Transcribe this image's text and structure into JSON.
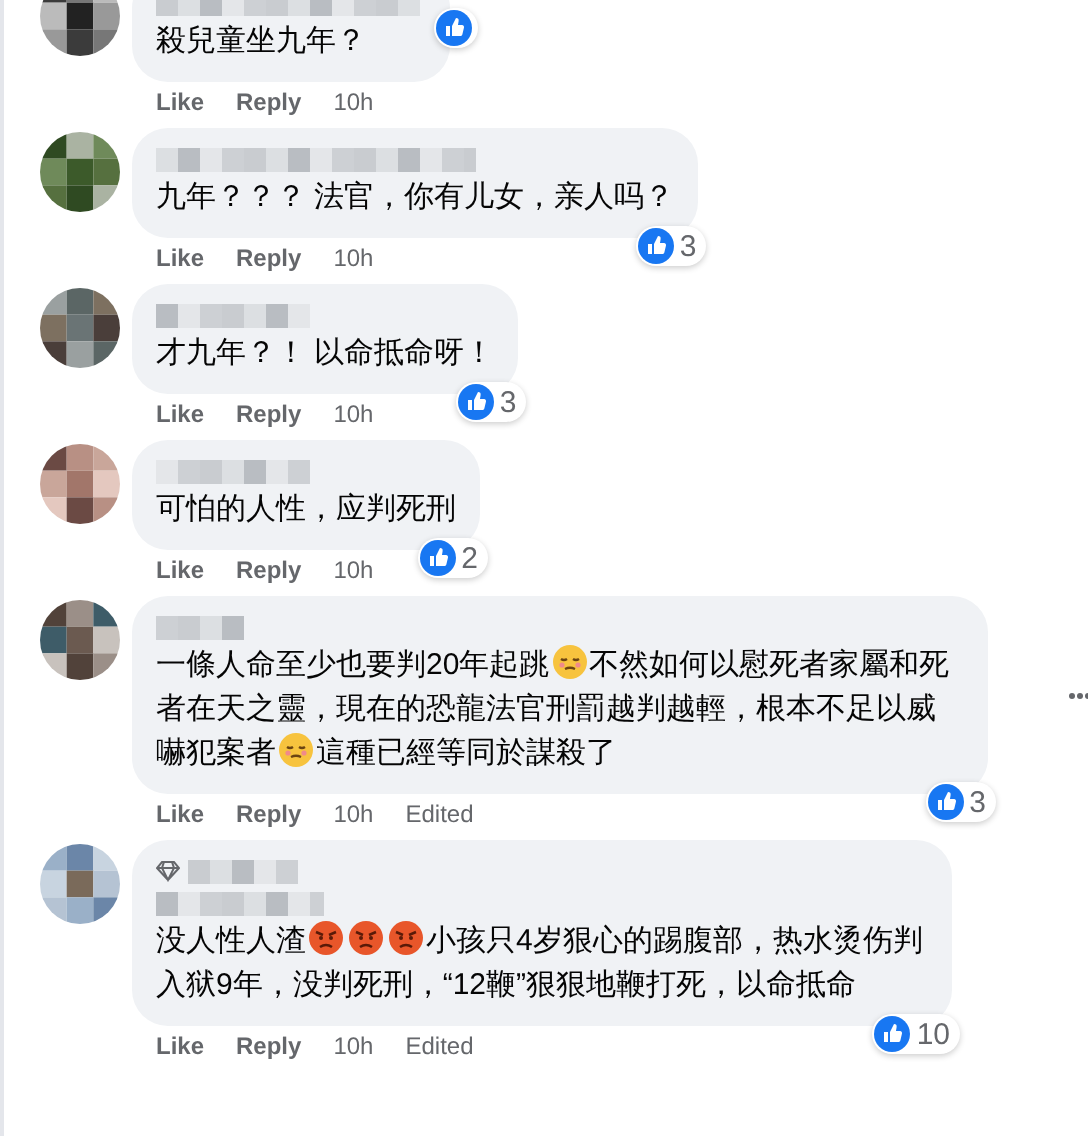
{
  "comments": [
    {
      "segments": [
        {
          "kind": "text",
          "text": "殺兒童坐九年？"
        }
      ],
      "top_fan": false,
      "has_menu": false,
      "reaction": {
        "kind": "side"
      },
      "actions": [
        "Like",
        "Reply"
      ],
      "time": "10h"
    },
    {
      "segments": [
        {
          "kind": "text",
          "text": "九年？？？ 法官，你有儿女，亲人吗？"
        }
      ],
      "top_fan": false,
      "has_menu": false,
      "reaction": {
        "kind": "below",
        "count": "3"
      },
      "actions": [
        "Like",
        "Reply"
      ],
      "time": "10h"
    },
    {
      "segments": [
        {
          "kind": "text",
          "text": "才九年？！ 以命抵命呀！"
        }
      ],
      "top_fan": false,
      "has_menu": false,
      "reaction": {
        "kind": "below",
        "count": "3"
      },
      "actions": [
        "Like",
        "Reply"
      ],
      "time": "10h"
    },
    {
      "segments": [
        {
          "kind": "text",
          "text": "可怕的人性，应判死刑"
        }
      ],
      "top_fan": false,
      "has_menu": false,
      "reaction": {
        "kind": "below",
        "count": "2"
      },
      "actions": [
        "Like",
        "Reply"
      ],
      "time": "10h"
    },
    {
      "segments": [
        {
          "kind": "text",
          "text": "一條人命至少也要判20年起跳"
        },
        {
          "kind": "pensive"
        },
        {
          "kind": "text",
          "text": "不然如何以慰死者家屬和死者在天之靈，現在的恐龍法官刑罰越判越輕，根本不足以威嚇犯案者"
        },
        {
          "kind": "pensive"
        },
        {
          "kind": "text",
          "text": "這種已經等同於謀殺了"
        }
      ],
      "top_fan": false,
      "has_menu": true,
      "reaction": {
        "kind": "below",
        "count": "3"
      },
      "actions": [
        "Like",
        "Reply"
      ],
      "time": "10h",
      "edited": "Edited"
    },
    {
      "segments": [
        {
          "kind": "text",
          "text": "没人性人渣"
        },
        {
          "kind": "angry"
        },
        {
          "kind": "angry"
        },
        {
          "kind": "angry"
        },
        {
          "kind": "text",
          "text": "小孩只4岁狠心的踢腹部，热水烫伤判入狱9年，没判死刑，“12鞭”狠狠地鞭打死，以命抵命"
        }
      ],
      "top_fan": true,
      "has_menu": false,
      "reaction": {
        "kind": "below",
        "count": "10"
      },
      "actions": [
        "Like",
        "Reply"
      ],
      "time": "10h",
      "edited": "Edited"
    }
  ]
}
